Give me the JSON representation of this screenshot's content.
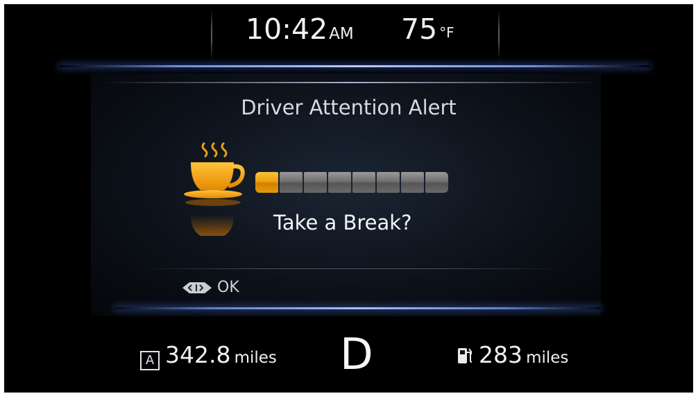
{
  "status_bar": {
    "time": "10:42",
    "time_period": "AM",
    "temperature": "75",
    "temperature_unit": "°F"
  },
  "alert": {
    "title": "Driver Attention Alert",
    "message": "Take a Break?",
    "icon": "coffee-cup-icon",
    "attention_level": {
      "filled_segments": 1,
      "total_segments": 8
    },
    "dismiss_control_icon": "steering-switch-icon",
    "dismiss_label": "OK"
  },
  "bottom_bar": {
    "trip_indicator": "A",
    "trip_value": "342.8",
    "trip_unit": "miles",
    "gear": "D",
    "fuel_icon": "fuel-pump-icon",
    "fuel_range_value": "283",
    "fuel_range_unit": "miles"
  },
  "colors": {
    "accent_amber": "#f0a010",
    "inactive_segment": "#6f6f6f",
    "glow_blue": "#6f8fd8",
    "text": "#eef1f6"
  }
}
